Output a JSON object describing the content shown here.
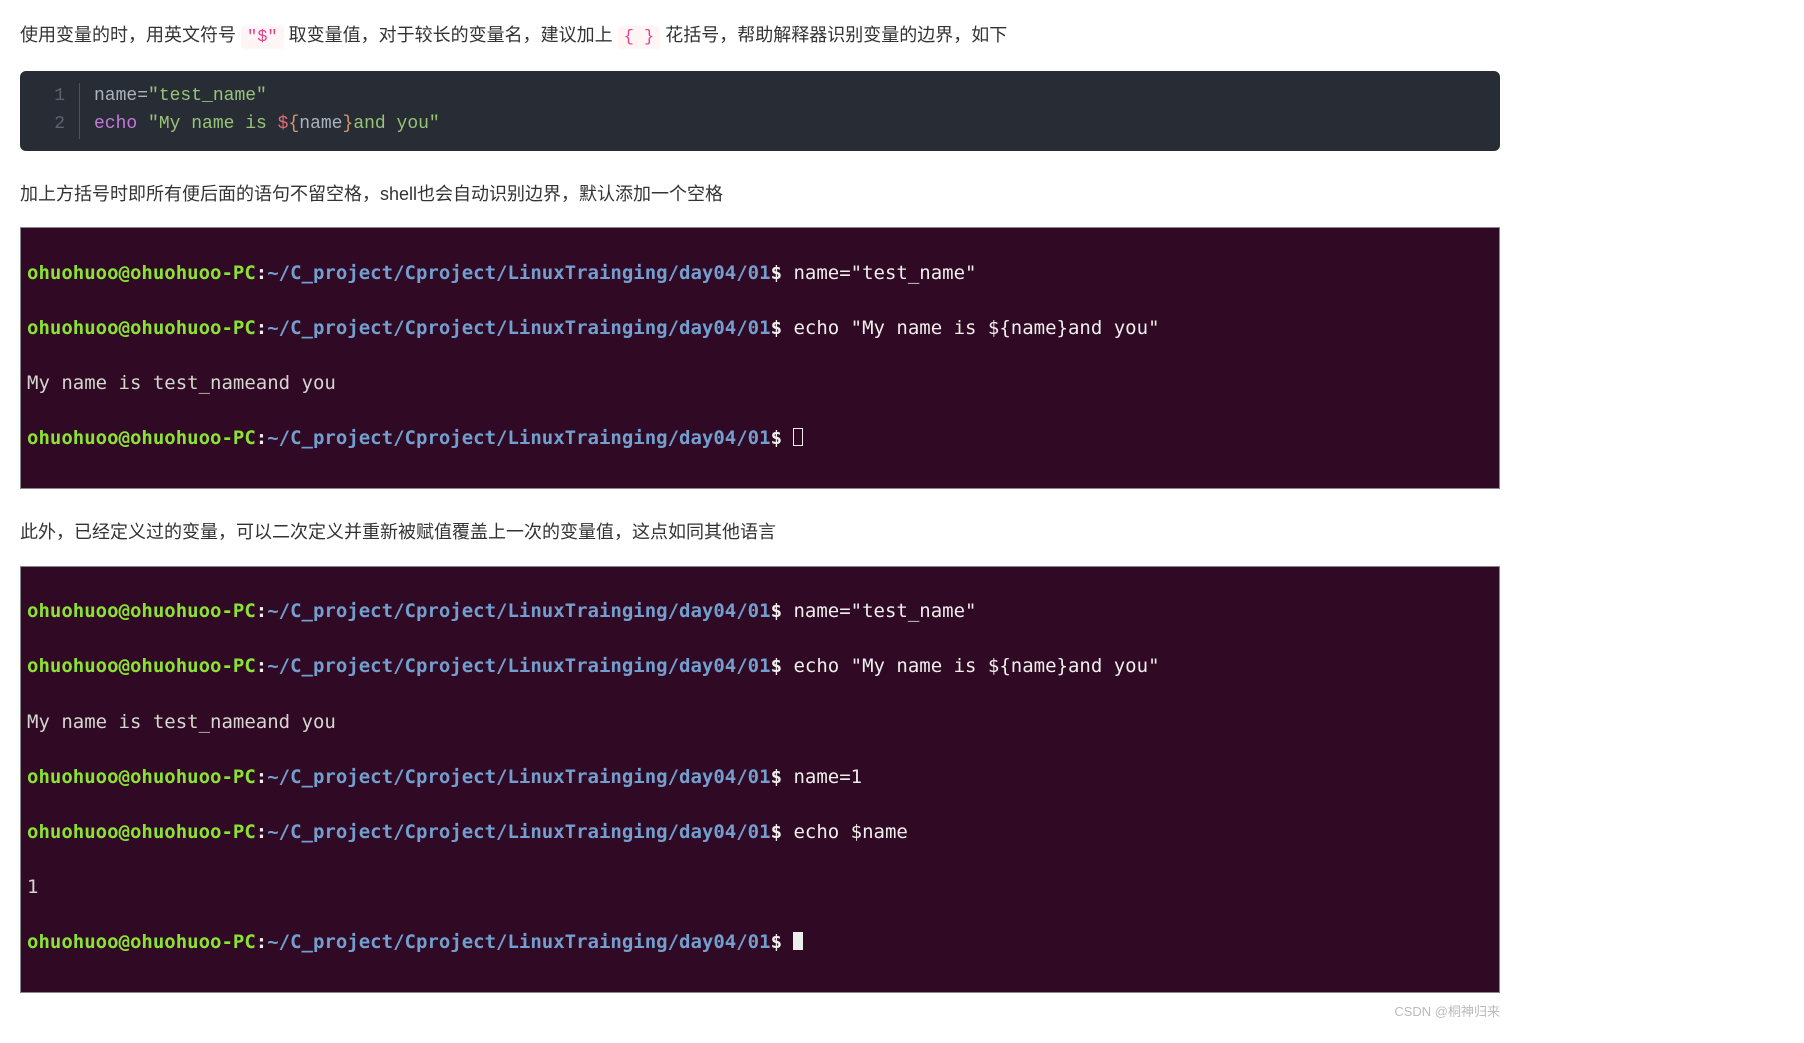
{
  "para1": {
    "s1": "使用变量的时，用英文符号 ",
    "code1": "\"$\"",
    "s2": " 取变量值，对于较长的变量名，建议加上 ",
    "code2": "{ }",
    "s3": " 花括号，帮助解释器识别变量的边界，如下"
  },
  "codeblock": {
    "line1_num": "1",
    "line2_num": "2",
    "l1_ident": "name",
    "l1_eq": "=",
    "l1_str": "\"test_name\"",
    "l2_kw": "echo",
    "l2_sp": " ",
    "l2_str1": "\"My name is ",
    "l2_dollar": "$",
    "l2_ob": "{",
    "l2_var": "name",
    "l2_cb": "}",
    "l2_str2": "and you\""
  },
  "para2": "加上方括号时即所有便后面的语句不留空格，shell也会自动识别边界，默认添加一个空格",
  "term_prompt": {
    "user": "ohuohuoo@ohuohuoo-PC",
    "colon": ":",
    "path": "~/C_project/Cproject/LinuxTrainging/day04/01",
    "dollar": "$"
  },
  "term1": {
    "cmd1": " name=\"test_name\"",
    "cmd2": " echo \"My name is ${name}and you\"",
    "out1": "My name is test_nameand you"
  },
  "para3": "此外，已经定义过的变量，可以二次定义并重新被赋值覆盖上一次的变量值，这点如同其他语言",
  "term2": {
    "cmd1": " name=\"test_name\"",
    "cmd2": " echo \"My name is ${name}and you\"",
    "out1": "My name is test_nameand you",
    "cmd3": " name=1",
    "cmd4": " echo $name",
    "out2": "1"
  },
  "watermark": "CSDN @桐神归来"
}
